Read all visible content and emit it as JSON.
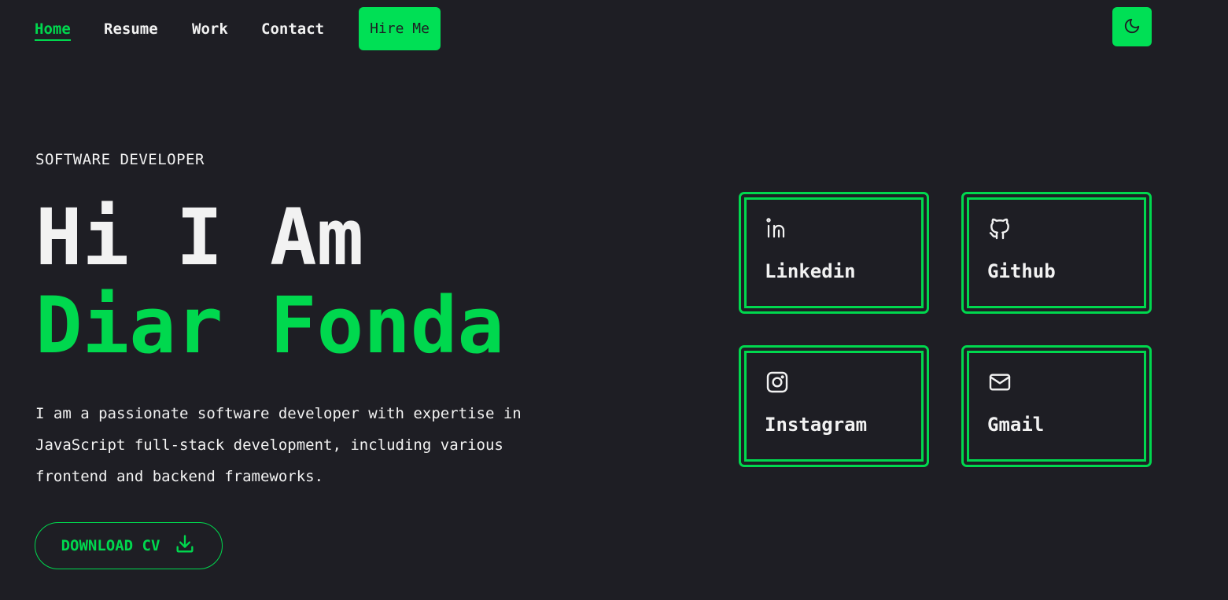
{
  "nav": {
    "links": [
      "Home",
      "Resume",
      "Work",
      "Contact"
    ],
    "active": "Home",
    "hire_label": "Hire Me",
    "theme_icon": "moon-icon"
  },
  "hero": {
    "subtitle": "SOFTWARE DEVELOPER",
    "greeting": "Hi I Am",
    "name": "Diar Fonda",
    "bio": "I am a passionate software developer with expertise in JavaScript full-stack development, including various frontend and backend frameworks.",
    "download_label": "DOWNLOAD CV",
    "download_icon": "download-icon"
  },
  "social": [
    {
      "label": "Linkedin",
      "icon": "linkedin-icon"
    },
    {
      "label": "Github",
      "icon": "github-icon"
    },
    {
      "label": "Instagram",
      "icon": "instagram-icon"
    },
    {
      "label": "Gmail",
      "icon": "mail-icon"
    }
  ],
  "colors": {
    "background": "#1e1e24",
    "accent": "#00d84e",
    "text": "#f2f2f2"
  }
}
